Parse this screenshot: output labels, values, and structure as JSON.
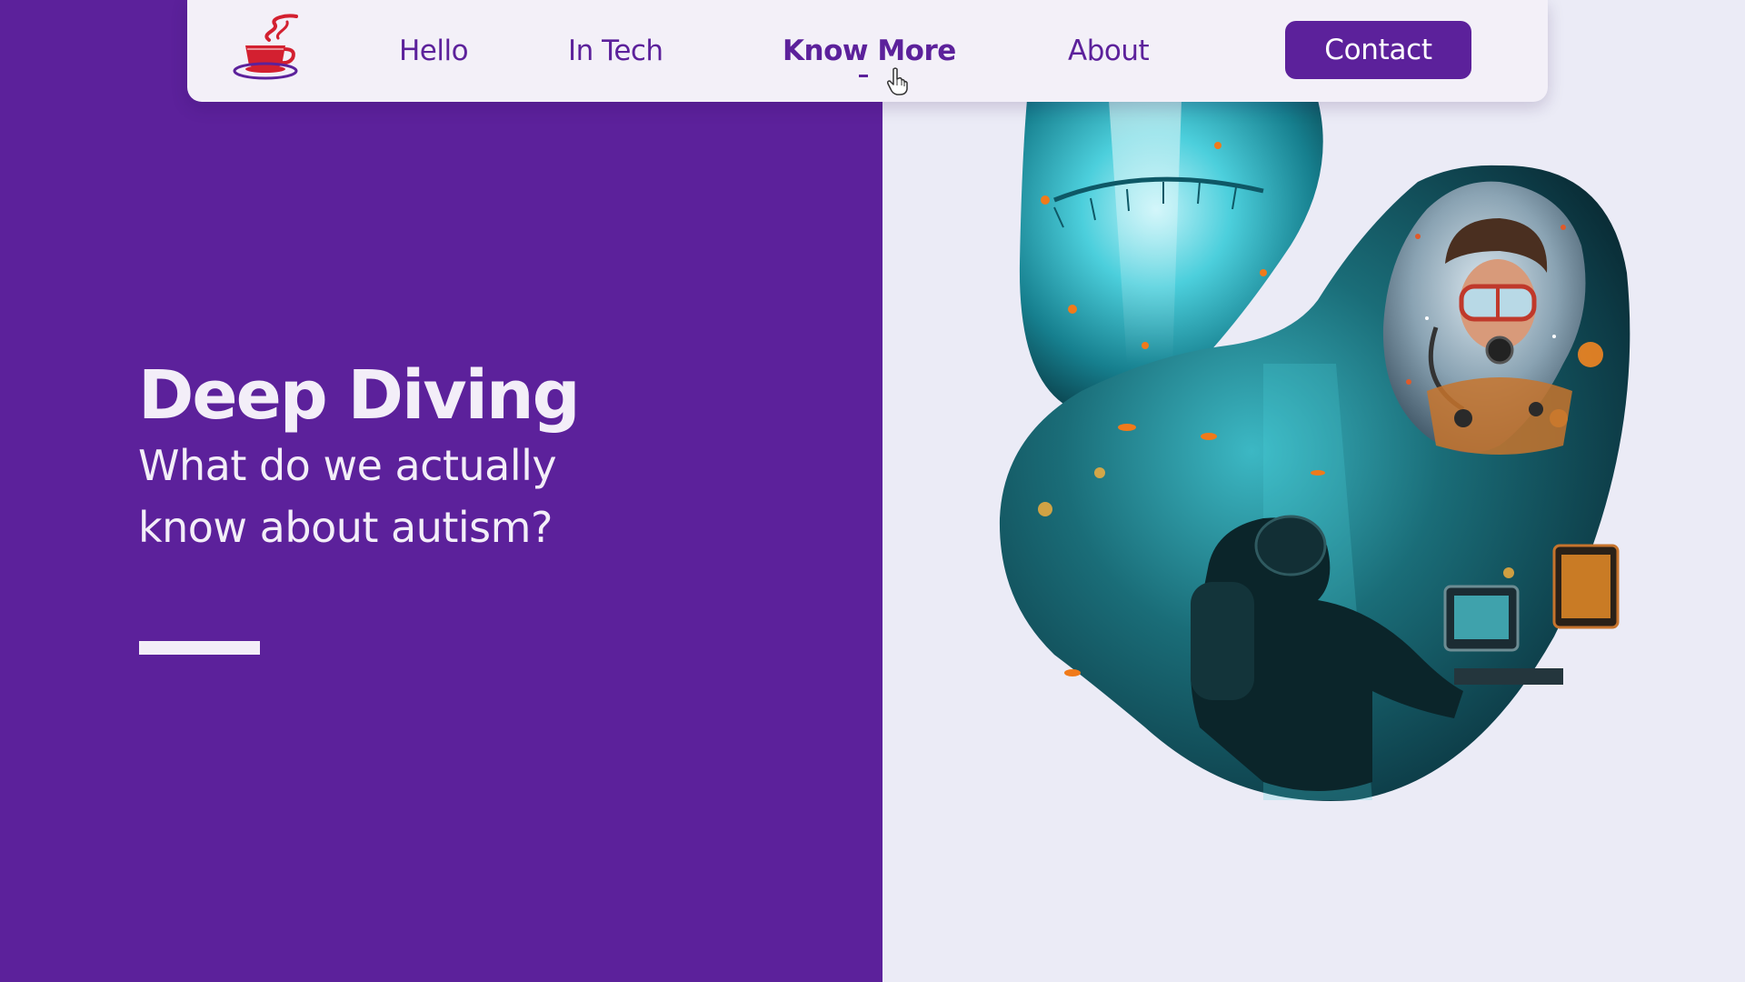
{
  "nav": {
    "logo": "coffee-cup-logo",
    "links": [
      {
        "label": "Hello",
        "active": false
      },
      {
        "label": "In Tech",
        "active": false
      },
      {
        "label": "Know More",
        "active": true
      },
      {
        "label": "About",
        "active": false
      }
    ],
    "contact_label": "Contact"
  },
  "hero": {
    "title": "Deep Diving",
    "subtitle": "What do we actually know about autism?"
  },
  "colors": {
    "brand_purple": "#5c219b",
    "page_background": "#ebebf6",
    "navbar_background": "#f3f0f8",
    "light_text": "#f3eef8",
    "logo_red": "#d32030",
    "underwater_teal": "#1fa3b8"
  },
  "images": {
    "top_blob": "underwater-jungle-bridge-illustration",
    "main_blob": "diver-at-computer-underwater-illustration",
    "inset_blob": "scuba-diver-portrait-illustration"
  }
}
